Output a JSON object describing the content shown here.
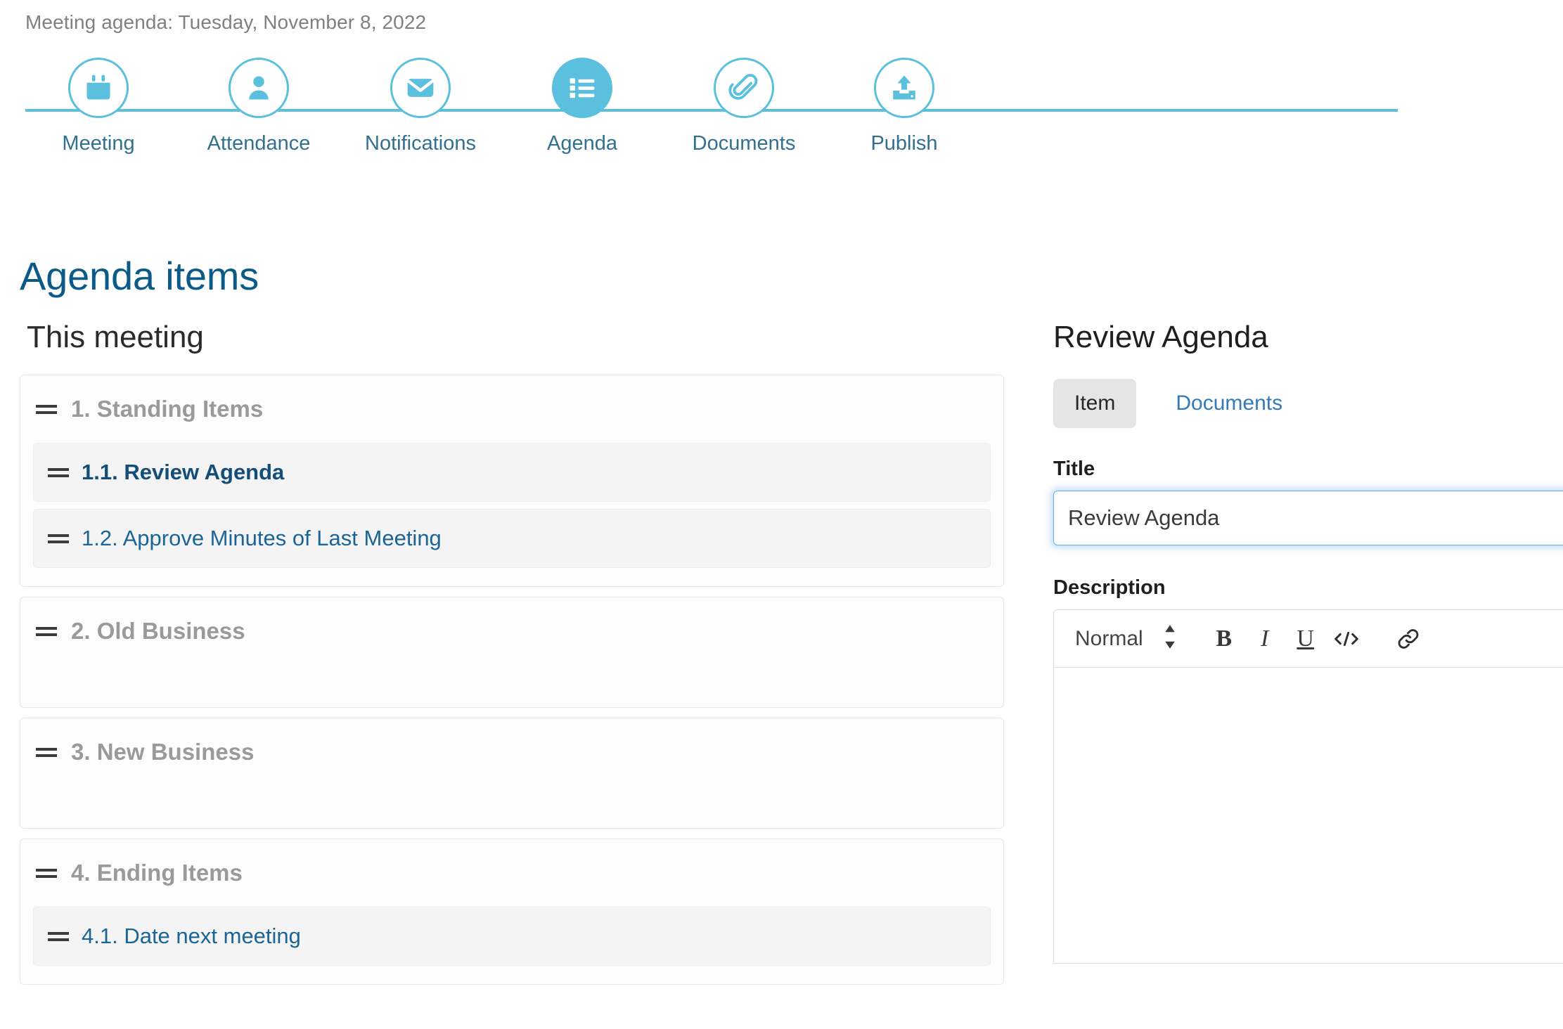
{
  "header": {
    "meeting_subtitle": "Meeting agenda: Tuesday, November 8, 2022"
  },
  "stepper": {
    "accent_color": "#5bc0de",
    "label_color": "#31708f",
    "active_step": "Agenda",
    "steps": [
      {
        "label": "Meeting",
        "icon": "calendar-icon",
        "active": false
      },
      {
        "label": "Attendance",
        "icon": "person-icon",
        "active": false
      },
      {
        "label": "Notifications",
        "icon": "envelope-icon",
        "active": false
      },
      {
        "label": "Agenda",
        "icon": "list-icon",
        "active": true
      },
      {
        "label": "Documents",
        "icon": "paperclip-icon",
        "active": false
      },
      {
        "label": "Publish",
        "icon": "upload-icon",
        "active": false
      }
    ]
  },
  "page": {
    "title": "Agenda items",
    "title_color": "#0b5a87"
  },
  "left": {
    "section_title": "This meeting",
    "cards": [
      {
        "label": "1. Standing Items",
        "subitems": [
          {
            "label": "1.1. Review Agenda",
            "selected": true
          },
          {
            "label": "1.2. Approve Minutes of Last Meeting",
            "selected": false
          }
        ]
      },
      {
        "label": "2. Old Business",
        "subitems": []
      },
      {
        "label": "3. New Business",
        "subitems": []
      },
      {
        "label": "4. Ending Items",
        "subitems": [
          {
            "label": "4.1. Date next meeting",
            "selected": false
          }
        ]
      }
    ]
  },
  "right": {
    "panel_title": "Review Agenda",
    "tabs": [
      {
        "label": "Item",
        "active": true
      },
      {
        "label": "Documents",
        "active": false
      }
    ],
    "title_field": {
      "label": "Title",
      "value": "Review Agenda",
      "placeholder": "",
      "focused": true,
      "focus_color": "#66afe9"
    },
    "description_field": {
      "label": "Description",
      "value": "",
      "toolbar": {
        "format_label": "Normal",
        "format_icon": "chevron-up-down-icon",
        "buttons": [
          {
            "name": "bold-button",
            "glyph": "B"
          },
          {
            "name": "italic-button",
            "glyph": "I"
          },
          {
            "name": "underline-button",
            "glyph": "U"
          },
          {
            "name": "code-button",
            "glyph": "</>"
          },
          {
            "name": "link-button",
            "glyph": "link"
          }
        ]
      }
    }
  }
}
